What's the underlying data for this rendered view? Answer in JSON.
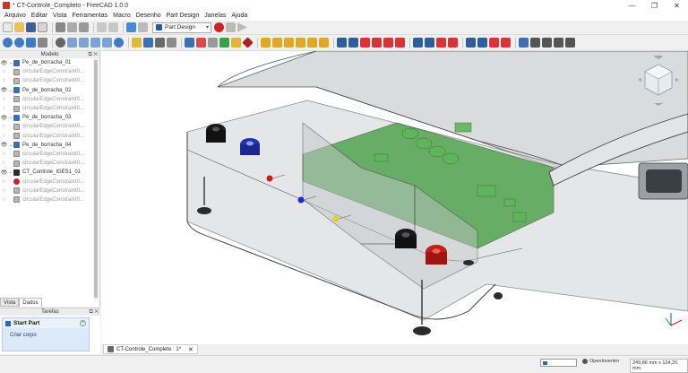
{
  "window": {
    "title": "* CT-Controle_Completo - FreeCAD 1.0.0",
    "minimize": "—",
    "maximize": "❐",
    "close": "✕"
  },
  "menu": [
    "Arquivo",
    "Editar",
    "Vista",
    "Ferramentas",
    "Macro",
    "Desenho",
    "Part Design",
    "Janelas",
    "Ajuda"
  ],
  "workbench": {
    "selected": "Part Design"
  },
  "model_panel": {
    "title": "Modelo",
    "tree": [
      {
        "label": "Pe_de_borracha_01",
        "type": "part",
        "visible": true,
        "expanded": true
      },
      {
        "label": "circularEdgeConstraint0...",
        "type": "constraint",
        "visible": false
      },
      {
        "label": "circularEdgeConstraint0...",
        "type": "constraint",
        "visible": false
      },
      {
        "label": "Pe_de_borracha_02",
        "type": "part",
        "visible": true,
        "expanded": true
      },
      {
        "label": "circularEdgeConstraint0...",
        "type": "constraint",
        "visible": false
      },
      {
        "label": "circularEdgeConstraint0...",
        "type": "constraint",
        "visible": false
      },
      {
        "label": "Pe_de_borracha_03",
        "type": "part",
        "visible": true,
        "expanded": true
      },
      {
        "label": "circularEdgeConstraint0...",
        "type": "constraint",
        "visible": false
      },
      {
        "label": "circularEdgeConstraint0...",
        "type": "constraint",
        "visible": false
      },
      {
        "label": "Pe_de_borracha_04",
        "type": "part",
        "visible": true,
        "expanded": true
      },
      {
        "label": "circularEdgeConstraint0...",
        "type": "constraint",
        "visible": false
      },
      {
        "label": "circularEdgeConstraint0...",
        "type": "constraint",
        "visible": false
      },
      {
        "label": "CT_Controle_IGES1_01",
        "type": "step",
        "visible": true,
        "expanded": true
      },
      {
        "label": "circularEdgeConstraint0...",
        "type": "err",
        "visible": false
      },
      {
        "label": "circularEdgeConstraint0...",
        "type": "constraint",
        "visible": false
      },
      {
        "label": "circularEdgeConstraint0...",
        "type": "constraint",
        "visible": false
      }
    ]
  },
  "tabs": [
    "Vista",
    "Dados"
  ],
  "tasks": {
    "title": "Tarefas",
    "section": "Start Part",
    "item": "Criar corpo"
  },
  "document_tab": {
    "label": "CT-Controle_Completo : 1*"
  },
  "statusbar": {
    "navigation": "OpenInventor",
    "dimensions": "249,86 mm x 124,20 mm"
  },
  "colors": {
    "pcb": "#3f9a3c",
    "case": "#cfd2d4",
    "red_connector": "#c0201a",
    "blue_connector": "#2233b0",
    "black_connector": "#1a1a1a",
    "accent": "#2d6ab3"
  }
}
